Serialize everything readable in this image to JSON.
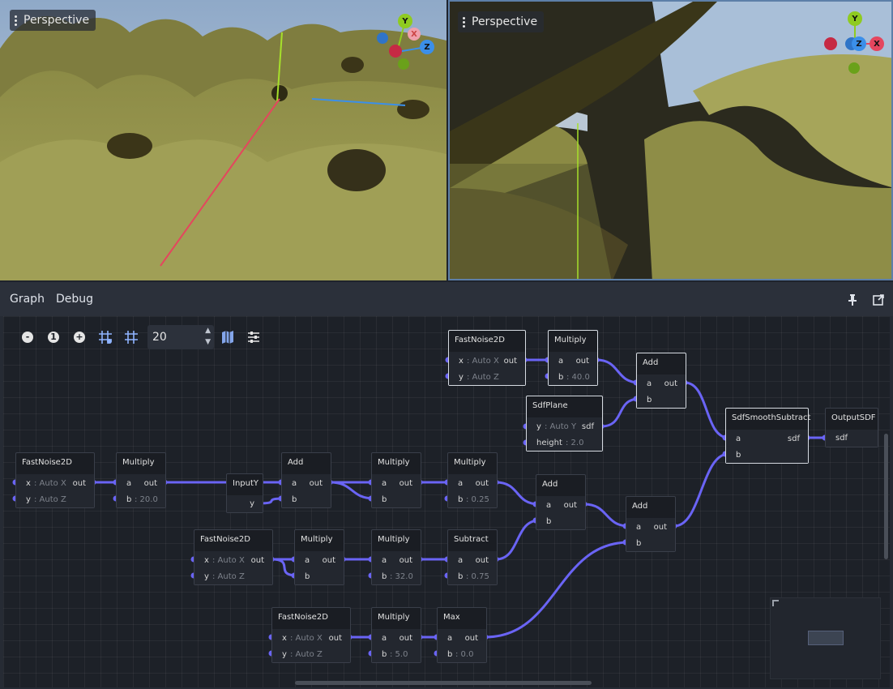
{
  "viewports": [
    {
      "label": "Perspective"
    },
    {
      "label": "Perspective"
    }
  ],
  "gizmo_axes": {
    "y": "Y",
    "x": "X",
    "z": "Z"
  },
  "colors": {
    "x_axis": "#e4465e",
    "y_axis": "#8fcb21",
    "z_axis": "#3b8fe9",
    "port": "#6a64f5",
    "wire": "#6a64f5",
    "terrain": "#a7a65a"
  },
  "tabs": {
    "graph": "Graph",
    "debug": "Debug"
  },
  "header_icons": [
    "pin-icon",
    "pop-out-icon"
  ],
  "toolbar": {
    "zoom_out": "-",
    "zoom_reset": "1",
    "zoom_in": "+",
    "snap_distance": "20"
  },
  "nodes": {
    "fn_top": {
      "title": "FastNoise2D",
      "x": "x",
      "x_hint": ": Auto X",
      "out": "out",
      "y": "y",
      "y_hint": ": Auto Z"
    },
    "mul_top": {
      "title": "Multiply",
      "a": "a",
      "out": "out",
      "b": "b",
      "b_hint": ": 40.0"
    },
    "add_top": {
      "title": "Add",
      "a": "a",
      "out": "out",
      "b": "b"
    },
    "sdfplane": {
      "title": "SdfPlane",
      "y": "y",
      "y_hint": ": Auto Y",
      "sdf": "sdf",
      "height": "height",
      "height_hint": ": 2.0"
    },
    "smooth": {
      "title": "SdfSmoothSubtract",
      "a": "a",
      "sdf": "sdf",
      "b": "b"
    },
    "output": {
      "title": "OutputSDF",
      "sdf": "sdf"
    },
    "fn_left": {
      "title": "FastNoise2D",
      "x": "x",
      "x_hint": ": Auto X",
      "out": "out",
      "y": "y",
      "y_hint": ": Auto Z"
    },
    "mul_left": {
      "title": "Multiply",
      "a": "a",
      "out": "out",
      "b": "b",
      "b_hint": ": 20.0"
    },
    "inputy": {
      "title": "InputY",
      "y": "y"
    },
    "add_mid": {
      "title": "Add",
      "a": "a",
      "out": "out",
      "b": "b"
    },
    "mul_mid1": {
      "title": "Multiply",
      "a": "a",
      "out": "out",
      "b": "b"
    },
    "mul_mid2": {
      "title": "Multiply",
      "a": "a",
      "out": "out",
      "b": "b",
      "b_hint": ": 0.25"
    },
    "add_r1": {
      "title": "Add",
      "a": "a",
      "out": "out",
      "b": "b"
    },
    "add_r2": {
      "title": "Add",
      "a": "a",
      "out": "out",
      "b": "b"
    },
    "fn_mid": {
      "title": "FastNoise2D",
      "x": "x",
      "x_hint": ": Auto X",
      "out": "out",
      "y": "y",
      "y_hint": ": Auto Z"
    },
    "mul_m1": {
      "title": "Multiply",
      "a": "a",
      "out": "out",
      "b": "b"
    },
    "mul_m2": {
      "title": "Multiply",
      "a": "a",
      "out": "out",
      "b": "b",
      "b_hint": ": 32.0"
    },
    "subtract": {
      "title": "Subtract",
      "a": "a",
      "out": "out",
      "b": "b",
      "b_hint": ": 0.75"
    },
    "fn_bot": {
      "title": "FastNoise2D",
      "x": "x",
      "x_hint": ": Auto X",
      "out": "out",
      "y": "y",
      "y_hint": ": Auto Z"
    },
    "mul_bot": {
      "title": "Multiply",
      "a": "a",
      "out": "out",
      "b": "b",
      "b_hint": ": 5.0"
    },
    "max": {
      "title": "Max",
      "a": "a",
      "out": "out",
      "b": "b",
      "b_hint": ": 0.0"
    }
  }
}
